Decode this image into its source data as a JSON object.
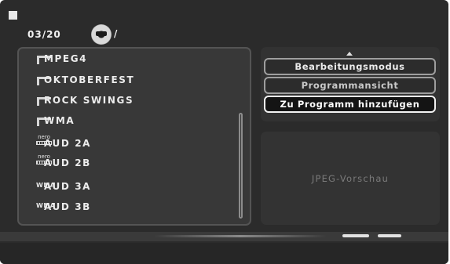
{
  "header": {
    "counter": "03/20",
    "path": "/"
  },
  "file_list": [
    {
      "label": "MPEG4",
      "icon": "folder-icon"
    },
    {
      "label": "OKTOBERFEST",
      "icon": "folder-icon"
    },
    {
      "label": "ROCK SWINGS",
      "icon": "folder-icon"
    },
    {
      "label": "WMA",
      "icon": "folder-icon"
    },
    {
      "label": "AUD 2A",
      "icon": "nero-file-icon"
    },
    {
      "label": "AUD 2B",
      "icon": "nero-file-icon"
    },
    {
      "label": "AUD 3A",
      "icon": "wma-file-icon"
    },
    {
      "label": "AUD 3B",
      "icon": "wma-file-icon"
    }
  ],
  "icons": {
    "nero_text": "nero",
    "wma_text": "WMA"
  },
  "menu": {
    "edit_mode": "Bearbeitungsmodus",
    "program_view": "Programmansicht",
    "add_to_program": "Zu Programm hinzufügen"
  },
  "preview": {
    "label": "JPEG-Vorschau"
  },
  "colors": {
    "background": "#2b2b2b",
    "panel": "#383838",
    "text": "#ececec"
  }
}
